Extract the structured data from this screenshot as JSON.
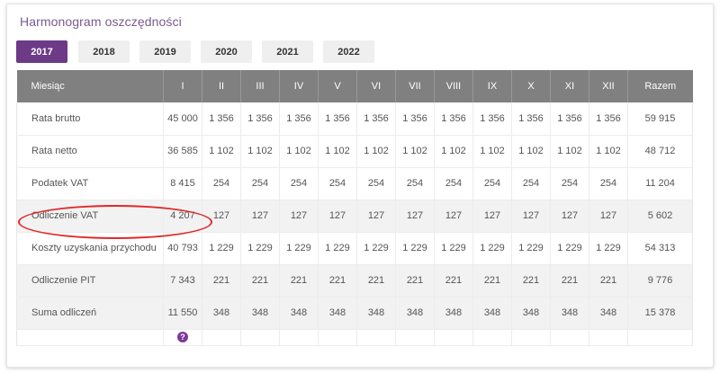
{
  "title": "Harmonogram oszczędności",
  "years": [
    "2017",
    "2018",
    "2019",
    "2020",
    "2021",
    "2022"
  ],
  "active_year": "2017",
  "table": {
    "headers": [
      "Miesiąc",
      "I",
      "II",
      "III",
      "IV",
      "V",
      "VI",
      "VII",
      "VIII",
      "IX",
      "X",
      "XI",
      "XII",
      "Razem"
    ],
    "rows": [
      {
        "label": "Rata brutto",
        "values": [
          "45 000",
          "1 356",
          "1 356",
          "1 356",
          "1 356",
          "1 356",
          "1 356",
          "1 356",
          "1 356",
          "1 356",
          "1 356",
          "1 356",
          "59 915"
        ]
      },
      {
        "label": "Rata netto",
        "values": [
          "36 585",
          "1 102",
          "1 102",
          "1 102",
          "1 102",
          "1 102",
          "1 102",
          "1 102",
          "1 102",
          "1 102",
          "1 102",
          "1 102",
          "48 712"
        ]
      },
      {
        "label": "Podatek VAT",
        "values": [
          "8 415",
          "254",
          "254",
          "254",
          "254",
          "254",
          "254",
          "254",
          "254",
          "254",
          "254",
          "254",
          "11 204"
        ]
      },
      {
        "label": "Odliczenie VAT",
        "values": [
          "4 207",
          "127",
          "127",
          "127",
          "127",
          "127",
          "127",
          "127",
          "127",
          "127",
          "127",
          "127",
          "5 602"
        ]
      },
      {
        "label": "Koszty uzyskania przychodu",
        "values": [
          "40 793",
          "1 229",
          "1 229",
          "1 229",
          "1 229",
          "1 229",
          "1 229",
          "1 229",
          "1 229",
          "1 229",
          "1 229",
          "1 229",
          "54 313"
        ]
      },
      {
        "label": "Odliczenie PIT",
        "values": [
          "7 343",
          "221",
          "221",
          "221",
          "221",
          "221",
          "221",
          "221",
          "221",
          "221",
          "221",
          "221",
          "9 776"
        ]
      },
      {
        "label": "Suma odliczeń",
        "values": [
          "11 550",
          "348",
          "348",
          "348",
          "348",
          "348",
          "348",
          "348",
          "348",
          "348",
          "348",
          "348",
          "15 378"
        ]
      }
    ],
    "footer_icon": "help-icon",
    "footer_icon_glyph": "?"
  },
  "colors": {
    "accent": "#6c3a86",
    "header_bg": "#808080",
    "title": "#7a5a8e",
    "highlight": "#e02828"
  }
}
